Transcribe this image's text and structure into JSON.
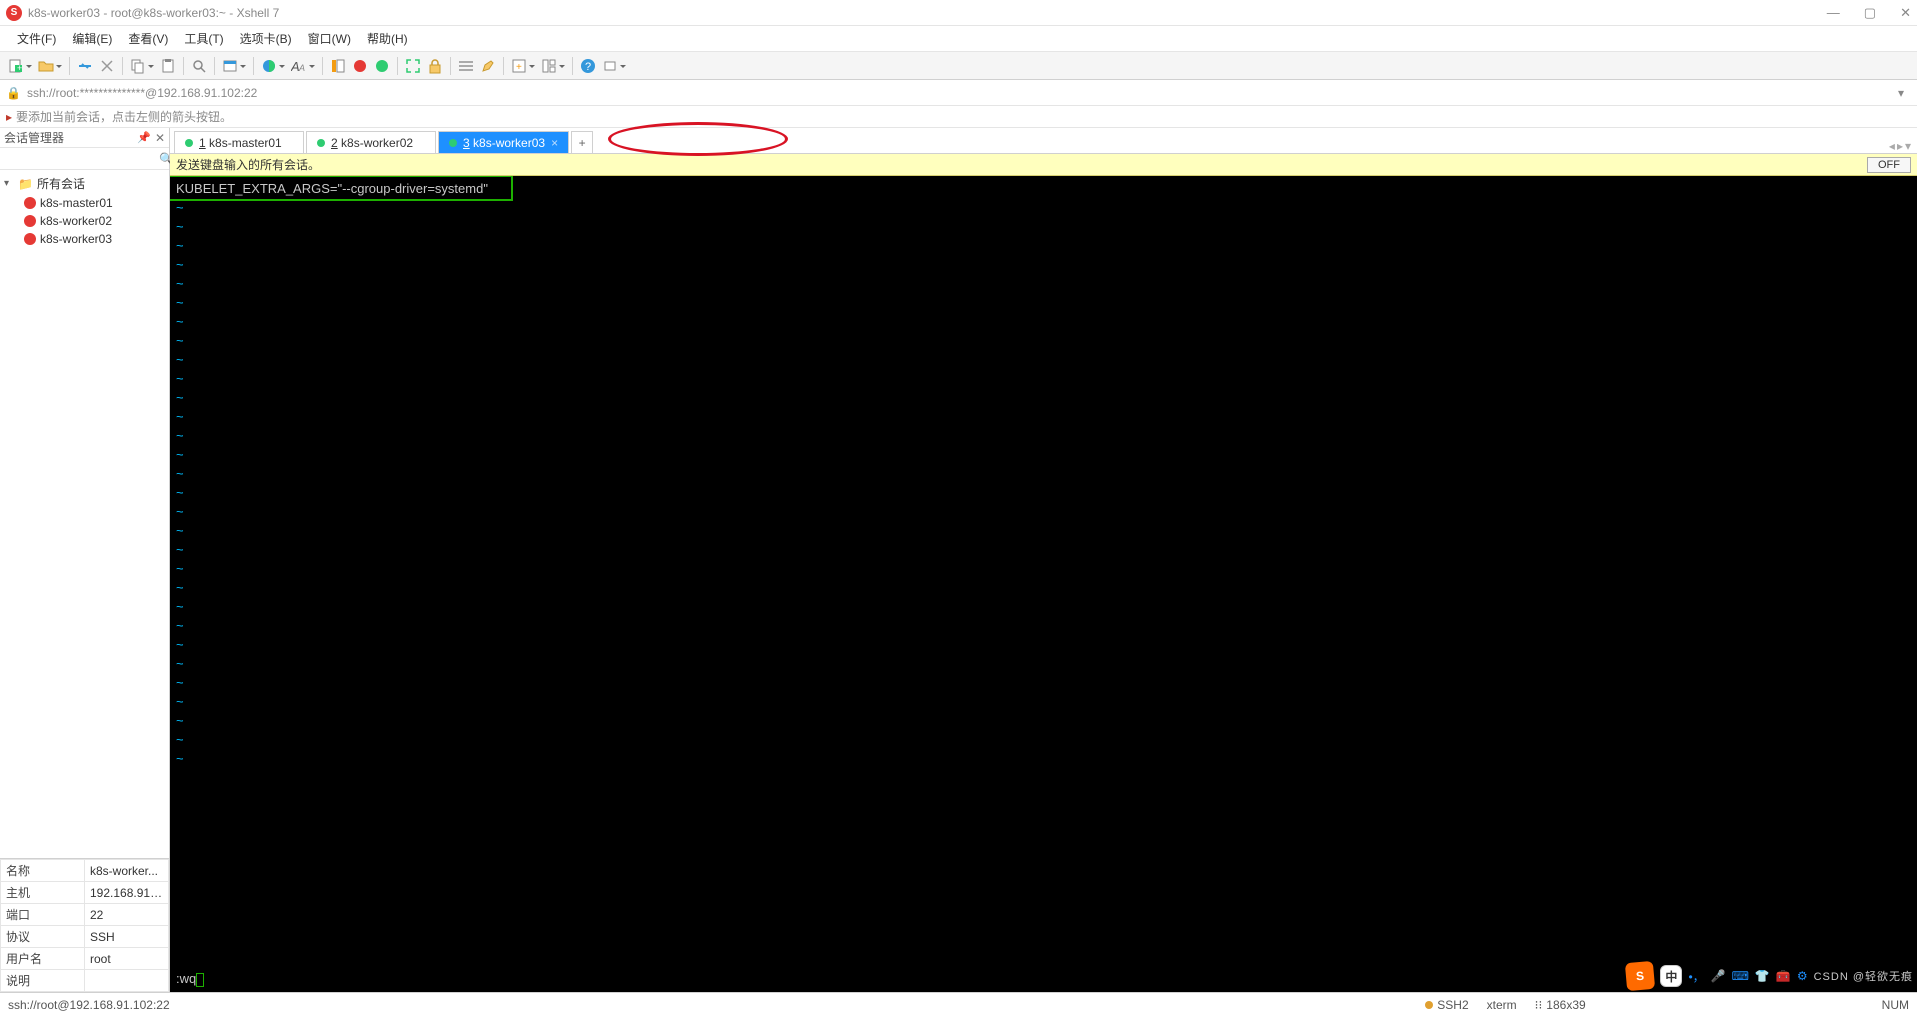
{
  "window": {
    "title": "k8s-worker03 - root@k8s-worker03:~ - Xshell 7"
  },
  "menus": [
    "文件(F)",
    "编辑(E)",
    "查看(V)",
    "工具(T)",
    "选项卡(B)",
    "窗口(W)",
    "帮助(H)"
  ],
  "address": "ssh://root:**************@192.168.91.102:22",
  "hint": "要添加当前会话，点击左侧的箭头按钮。",
  "sidebar": {
    "title": "会话管理器",
    "root": "所有会话",
    "items": [
      {
        "label": "k8s-master01"
      },
      {
        "label": "k8s-worker02"
      },
      {
        "label": "k8s-worker03"
      }
    ]
  },
  "props": {
    "rows": [
      {
        "k": "名称",
        "v": "k8s-worker..."
      },
      {
        "k": "主机",
        "v": "192.168.91...."
      },
      {
        "k": "端口",
        "v": "22"
      },
      {
        "k": "协议",
        "v": "SSH"
      },
      {
        "k": "用户名",
        "v": "root"
      },
      {
        "k": "说明",
        "v": ""
      }
    ]
  },
  "tabs": [
    {
      "num": "1",
      "label": "k8s-master01",
      "active": false
    },
    {
      "num": "2",
      "label": "k8s-worker02",
      "active": false
    },
    {
      "num": "3",
      "label": "k8s-worker03",
      "active": true
    }
  ],
  "yellowbar": {
    "text": "发送键盘输入的所有会话。",
    "off": "OFF"
  },
  "terminal": {
    "line1": "KUBELET_EXTRA_ARGS=\"--cgroup-driver=systemd\"",
    "cmd": ":wq"
  },
  "status": {
    "left": "ssh://root@192.168.91.102:22",
    "ssh": "SSH2",
    "term": "xterm",
    "size": "186x39",
    "caps": "NUM"
  },
  "ime": {
    "label": "中"
  },
  "watermark": "CSDN @轻欲无痕"
}
